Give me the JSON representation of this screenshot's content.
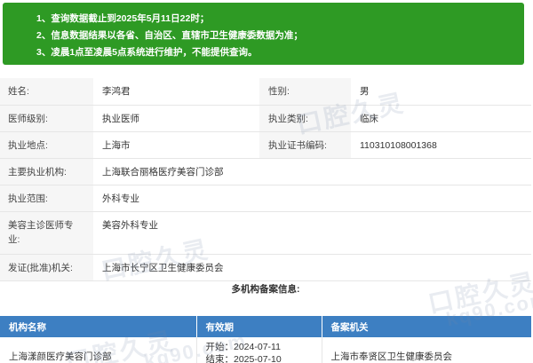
{
  "notice": {
    "lines": [
      "1、查询数据截止到2025年5月11日22时；",
      "2、信息数据结果以各省、自治区、直辖市卫生健康委数据为准；",
      "3、凌晨1点至凌晨5点系统进行维护，不能提供查询。"
    ],
    "background": "#2e9a24"
  },
  "doctor": {
    "name_label": "姓名:",
    "name": "李鸿君",
    "gender_label": "性别:",
    "gender": "男",
    "level_label": "医师级别:",
    "level": "执业医师",
    "category_label": "执业类别:",
    "category": "临床",
    "location_label": "执业地点:",
    "location": "上海市",
    "cert_label": "执业证书编码:",
    "cert": "110310108001368",
    "institution_label": "主要执业机构:",
    "institution": "上海联合丽格医疗美容门诊部",
    "scope_label": "执业范围:",
    "scope": "外科专业",
    "cosmetic_label": "美容主诊医师专业:",
    "cosmetic": "美容外科专业",
    "issuer_label": "发证(批准)机关:",
    "issuer": "上海市长宁区卫生健康委员会"
  },
  "multi_registration": {
    "title": "多机构备案信息:",
    "header_color": "#3d7fc2",
    "columns": {
      "org": "机构名称",
      "period": "有效期",
      "authority": "备案机关"
    },
    "rows": [
      {
        "org": "上海漾颜医疗美容门诊部",
        "start": "开始：2024-07-11",
        "end": "结束：2025-07-10",
        "authority": "上海市奉贤区卫生健康委员会"
      }
    ]
  },
  "watermark": {
    "brand_cn": "口腔久灵",
    "brand_en": "kq90.com"
  }
}
